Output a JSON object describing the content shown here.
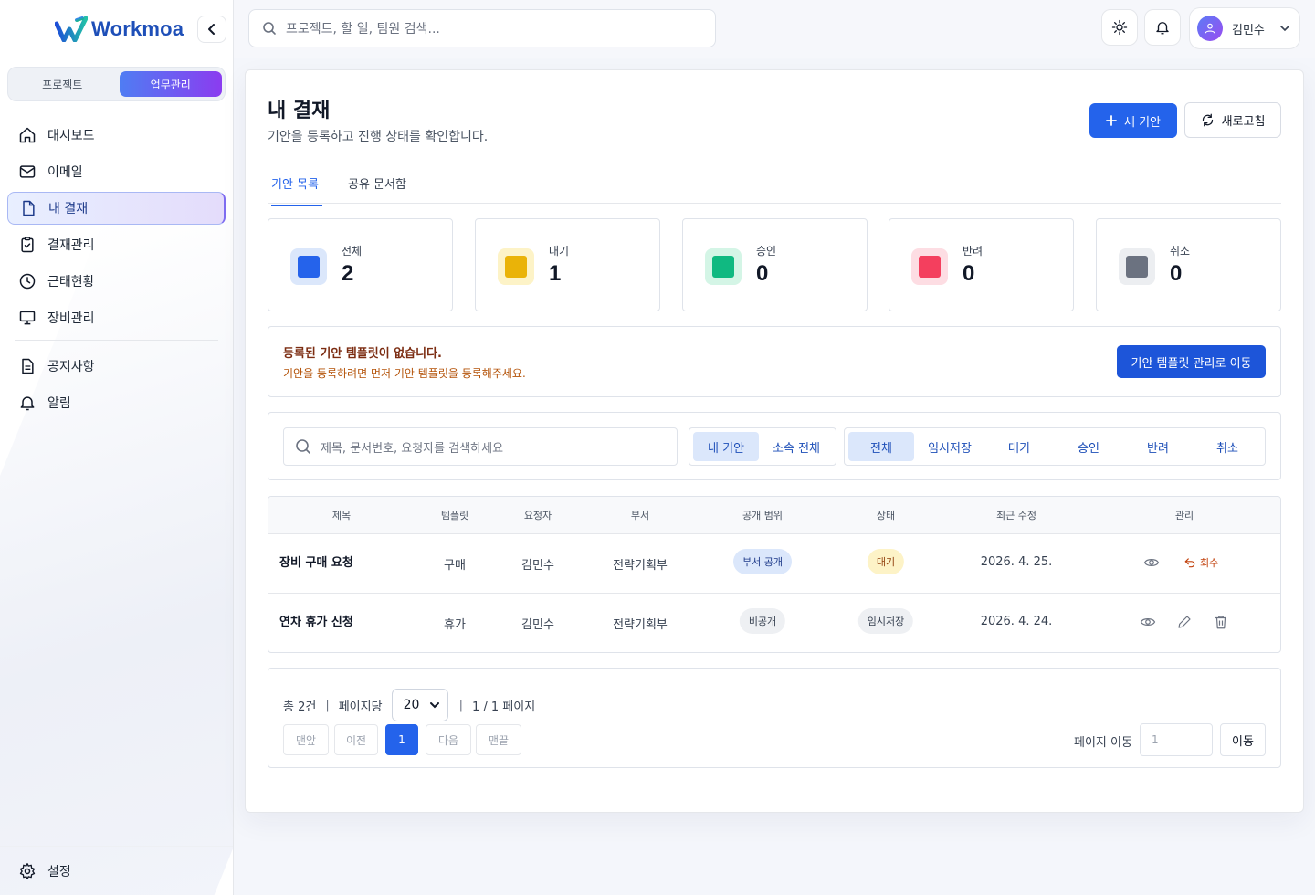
{
  "app": {
    "brand": "Workmoa"
  },
  "sidebar": {
    "mode": {
      "project": "프로젝트",
      "work": "업무관리"
    },
    "items": [
      {
        "label": "대시보드",
        "icon": "home-icon"
      },
      {
        "label": "이메일",
        "icon": "mail-icon"
      },
      {
        "label": "내 결재",
        "icon": "document-icon",
        "active": true
      },
      {
        "label": "결재관리",
        "icon": "clipboard-check-icon"
      },
      {
        "label": "근태현황",
        "icon": "clock-icon"
      },
      {
        "label": "장비관리",
        "icon": "monitor-icon"
      }
    ],
    "items2": [
      {
        "label": "공지사항",
        "icon": "notice-icon"
      },
      {
        "label": "알림",
        "icon": "bell-icon"
      }
    ],
    "settings": "설정"
  },
  "header": {
    "search_placeholder": "프로젝트, 할 일, 팀원 검색...",
    "user_name": "김민수"
  },
  "page": {
    "title": "내 결재",
    "subtitle": "기안을 등록하고 진행 상태를 확인합니다.",
    "new_button": "새 기안",
    "refresh_button": "새로고침",
    "tabs": [
      "기안 목록",
      "공유 문서함"
    ]
  },
  "stats": [
    {
      "label": "전체",
      "value": "2",
      "color": "#2563eb",
      "bg": "#dbe7fb"
    },
    {
      "label": "대기",
      "value": "1",
      "color": "#eab308",
      "bg": "#fdf3c7"
    },
    {
      "label": "승인",
      "value": "0",
      "color": "#10b981",
      "bg": "#d4f5e6"
    },
    {
      "label": "반려",
      "value": "0",
      "color": "#f43f5e",
      "bg": "#fddde3"
    },
    {
      "label": "취소",
      "value": "0",
      "color": "#6b7280",
      "bg": "#eceef1"
    }
  ],
  "notice": {
    "title": "등록된 기안 템플릿이 없습니다.",
    "desc": "기안을 등록하려면 먼저 기안 템플릿을 등록해주세요.",
    "button": "기안 템플릿 관리로 이동"
  },
  "filter": {
    "search_placeholder": "제목, 문서번호, 요청자를 검색하세요",
    "scope": [
      "내 기안",
      "소속 전체"
    ],
    "status": [
      "전체",
      "임시저장",
      "대기",
      "승인",
      "반려",
      "취소"
    ]
  },
  "table": {
    "headers": [
      "제목",
      "템플릿",
      "요청자",
      "부서",
      "공개 범위",
      "상태",
      "최근 수정",
      "관리"
    ],
    "rows": [
      {
        "title": "장비 구매 요청",
        "template": "구매",
        "requester": "김민수",
        "dept": "전략기획부",
        "visibility": "부서 공개",
        "status": "대기",
        "updated": "2026. 4. 25.",
        "action": "회수"
      },
      {
        "title": "연차 휴가 신청",
        "template": "휴가",
        "requester": "김민수",
        "dept": "전략기획부",
        "visibility": "비공개",
        "status": "임시저장",
        "updated": "2026. 4. 24."
      }
    ]
  },
  "pager": {
    "total": "총 2건",
    "per_page_label": "페이지당",
    "per_page": "20",
    "page_info": "1 / 1 페이지",
    "first": "맨앞",
    "prev": "이전",
    "current": "1",
    "next": "다음",
    "last": "맨끝",
    "jump_label": "페이지 이동",
    "jump_placeholder": "1",
    "jump_button": "이동"
  }
}
